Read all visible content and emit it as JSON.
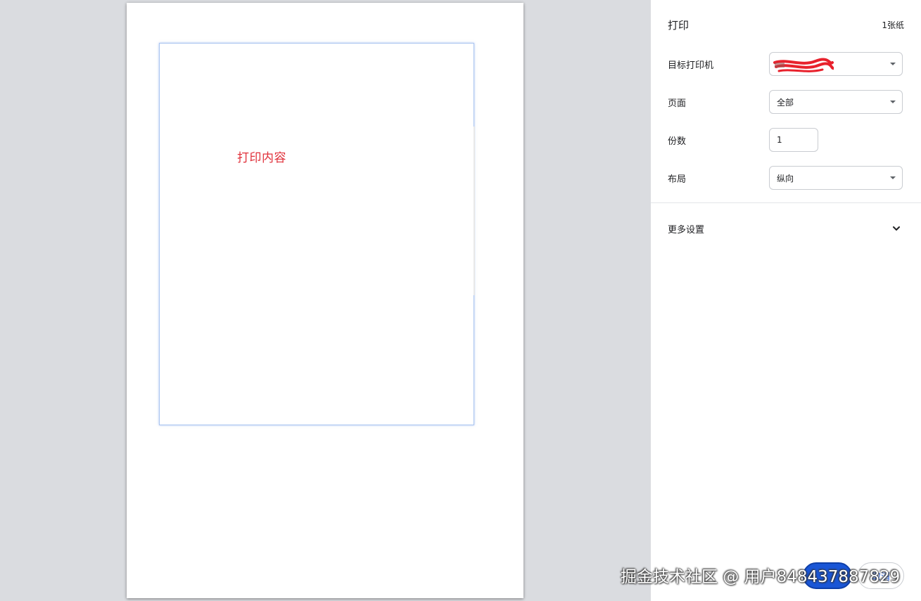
{
  "preview": {
    "content_text": "打印内容"
  },
  "panel": {
    "title": "打印",
    "sheet_count": "1张纸",
    "destination": {
      "label": "目标打印机",
      "value": ""
    },
    "pages": {
      "label": "页面",
      "value": "全部"
    },
    "copies": {
      "label": "份数",
      "value": "1"
    },
    "layout": {
      "label": "布局",
      "value": "纵向"
    },
    "more_settings": {
      "label": "更多设置"
    },
    "buttons": {
      "print": "",
      "cancel": "取消"
    }
  },
  "watermark": "掘金技术社区 @ 用户848437887829",
  "colors": {
    "accent": "#1a56d6",
    "content_text": "#e0303a",
    "background": "#dadce0"
  },
  "icons": {
    "select_arrow": "caret-down-icon",
    "more_settings": "chevron-down-icon"
  }
}
